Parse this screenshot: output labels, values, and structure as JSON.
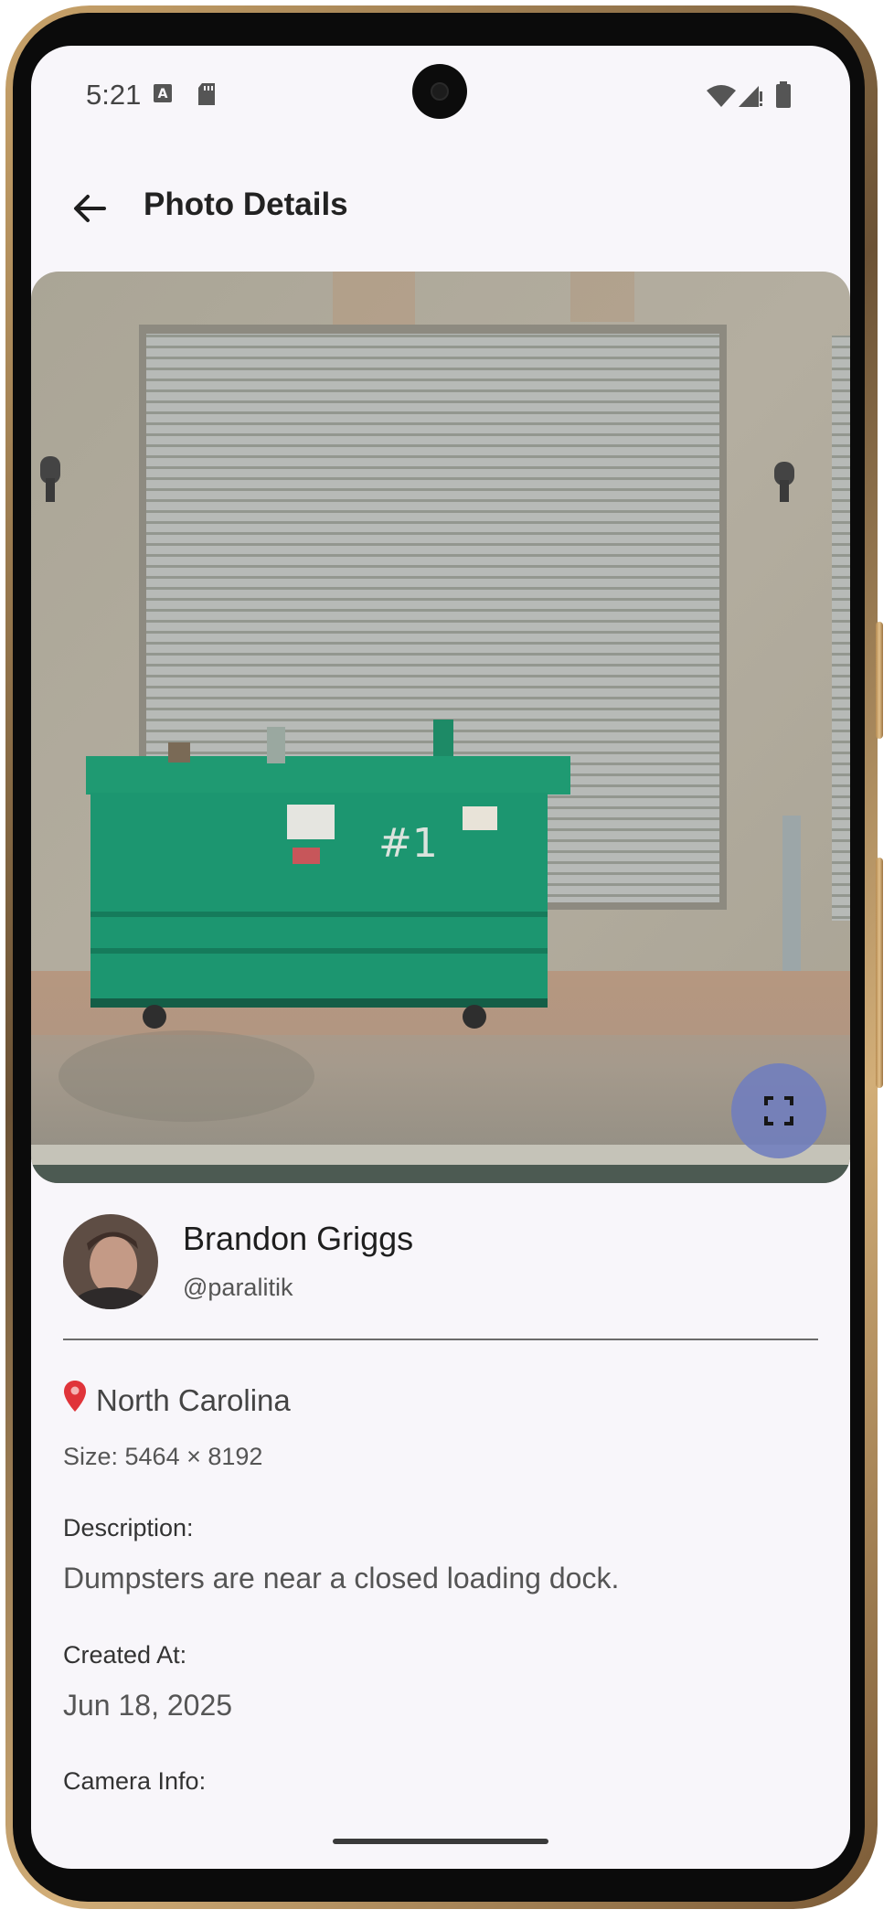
{
  "status_bar": {
    "time": "5:21",
    "icons": [
      "notification-a-icon",
      "sd-card-icon",
      "wifi-icon",
      "signal-icon",
      "battery-icon"
    ]
  },
  "app_bar": {
    "title": "Photo Details",
    "back_icon": "arrow-back-icon"
  },
  "photo": {
    "alt": "Dumpsters near a closed loading dock",
    "fullscreen_icon": "fullscreen-icon",
    "accent": "#707dbe"
  },
  "author": {
    "name": "Brandon Griggs",
    "handle": "@paralitik"
  },
  "details": {
    "location": "North Carolina",
    "size": "Size: 5464 × 8192",
    "description_label": "Description:",
    "description": "Dumpsters are near a closed loading dock.",
    "created_label": "Created At:",
    "created": "Jun 18, 2025",
    "camera_label": "Camera Info:"
  }
}
